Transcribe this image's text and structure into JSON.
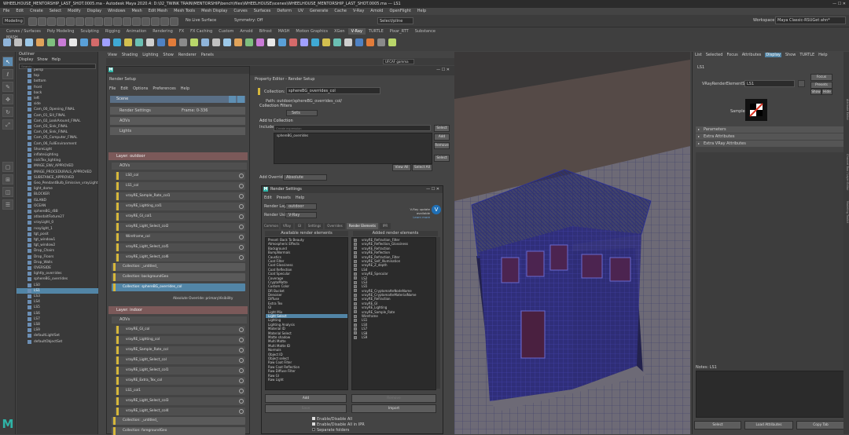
{
  "window": {
    "title": "WHEELHOUSE_MENTORSHIP_LAST_SHOT.0005.ma - Autodesk Maya 2020.4: D:\\02_TWINK TRAIN\\MENTORSHIP\\bench\\files\\WHEELHOUSE\\scenes\\WHEELHOUSE_MENTORSHIP_LAST_SHOT.0005.ma --- LS1"
  },
  "menu": [
    "File",
    "Edit",
    "Create",
    "Select",
    "Modify",
    "Display",
    "Windows",
    "Mesh",
    "Edit Mesh",
    "Mesh Tools",
    "Mesh Display",
    "Curves",
    "Surfaces",
    "Deform",
    "UV",
    "Generate",
    "Cache",
    "V-Ray",
    "Arnold",
    "OpenFlight",
    "Help"
  ],
  "status": {
    "mode": "Modeling",
    "no_live": "No Live Surface",
    "symmetry": "Symmetry: Off",
    "target": "Select/pline",
    "workspace_label": "Workspace :",
    "workspace": "Maya Classic-RSUGet ahn*"
  },
  "shelf_tabs": [
    "Curves / Surfaces",
    "Poly Modeling",
    "Sculpting",
    "Rigging",
    "Animation",
    "Rendering",
    "FX",
    "FX Caching",
    "Custom",
    "Arnold",
    "Bifrost",
    "MASH",
    "Motion Graphics",
    "XGen",
    "V-Ray",
    "TURTLE",
    "Pixar_RTT",
    "Substance",
    "MASH"
  ],
  "outliner": {
    "title": "Outliner",
    "menus": [
      "Display",
      "Show",
      "Help"
    ],
    "search_placeholder": "Search...",
    "items": [
      "persp",
      "top",
      "bottom",
      "front",
      "back",
      "left",
      "side",
      "Cam_00_Opening_FINAL",
      "Cam_01_Sill_FINAL",
      "Cam_02_LookAround_FINAL",
      "Cam_03_Sink_FINAL",
      "Cam_04_Sink_FINAL",
      "Cam_05_Computer_FINAL",
      "Cam_06_FullEnvironment",
      "ShoreLight",
      "inflateLighting",
      "nickTex_lighting",
      "IMAGE_ENV_APPROVED",
      "IMAGE_PROCEDURALS_APPROVED",
      "SUBSTANCE_APPROVED",
      "Geo_PendantBulb_Emissive_vrayLight",
      "light_dome",
      "BLOCKER",
      "ISLAND",
      "OCEAN",
      "sphereBG_rBB",
      "atlasdaltFixture27",
      "vrayLight_0",
      "rvaylight_1",
      "tgt_posit",
      "tgt_window1",
      "tgt_window2",
      "Drop_Chairs",
      "Drop_Floors",
      "Drop_Walls",
      "OVERSIDE",
      "lightly_overrides",
      "sphereBG_overrides",
      "LS0",
      "LS1",
      "LS3",
      "LS4",
      "LS5",
      "LS6",
      "LS7",
      "LS8",
      "LS9",
      "defaultLightSet",
      "defaultObjectSet"
    ],
    "selected_index": 39
  },
  "viewport": {
    "menus": [
      "View",
      "Shading",
      "Lighting",
      "Show",
      "Renderer",
      "Panels"
    ],
    "camera_field": "UFCAF gamma"
  },
  "render_setup": {
    "title": "Render Setup",
    "menus": [
      "File",
      "Edit",
      "Options",
      "Preferences",
      "Help"
    ],
    "scene": "Scene",
    "scene_items": [
      "Render Settings",
      "AOVs",
      "Lights"
    ],
    "frame": "Frame: 0-336",
    "layer1": "Layer:  outdoor",
    "aovs": "AOVs",
    "aov_items1": [
      "LS0_col",
      "LS1_col",
      "vrayRE_Sample_Rate_col1",
      "vrayRE_Lighting_col1",
      "vrayRE_GI_col1",
      "vrayRE_Light_Select_col2",
      "Wireframe_col",
      "vrayRE_Light_Select_col5",
      "vrayRE_Light_Select_col6"
    ],
    "collections1": [
      "Collection:  _untitled_",
      "Collection:  backgroundGeo",
      "Collection:  sphereBG_overrides_col"
    ],
    "abs_override": "Absolute Override:  primaryVisibility",
    "layer2": "Layer:  indoor",
    "aov_items2": [
      "vrayRE_GI_col",
      "vrayRE_Lighting_col",
      "vrayRE_Sample_Rate_col",
      "vrayRE_Light_Select_col",
      "vrayRE_Light_Select_col1",
      "vrayRE_Extra_Tex_col",
      "LS1_col1",
      "vrayRE_Light_Select_col3",
      "vrayRE_Light_Select_col4"
    ],
    "collections2": [
      "Collection:  _untitled_",
      "Collection:  foregroundGeo"
    ]
  },
  "property_editor": {
    "title": "Property Editor - Render Setup",
    "collection_label": "Collection:",
    "collection_value": "sphereBG_overrides_col",
    "path": "Path:  outdoor/sphereBG_overrides_col/",
    "filters": "Collection Filters",
    "filter_value": "Sets",
    "add_to": "Add to Collection",
    "include": "Include",
    "include_placeholder": "Create expression",
    "select": "Select",
    "list_item": "sphereBG_overrides",
    "add": "Add",
    "remove": "Remove",
    "select2": "Select",
    "view_all": "View All",
    "select_all": "Select All",
    "add_override": "Add Override",
    "override_type": "Absolute"
  },
  "render_settings": {
    "title": "Render Settings",
    "menus": [
      "Edit",
      "Presets",
      "Help"
    ],
    "layer_label": "Render Layer",
    "layer_value": "outdoor",
    "using_label": "Render Using",
    "using_value": "V-Ray",
    "update": "V-Ray update available",
    "learn_more": "Learn more",
    "tabs": [
      "Common",
      "VRay",
      "GI",
      "Settings",
      "Overrides",
      "Render Elements",
      "IPR"
    ],
    "active_tab": "Render Elements",
    "available_header": "Available render elements",
    "added_header": "Added render elements",
    "available": [
      "Preset: Back To Beauty",
      "Atmospheric Effects",
      "Background",
      "BumpNormals",
      "Caustics",
      "Coat Filter",
      "Coat Glossiness",
      "Coat Reflection",
      "Coat Specular",
      "Coverage",
      "CryptoMatte",
      "Custom Color",
      "DR Bucket",
      "Denoiser",
      "Diffuse",
      "Extra Tex",
      "GI",
      "Light Mix",
      "Light Select",
      "Lighting",
      "Lighting Analysis",
      "Material ID",
      "Material Select",
      "Matte shadow",
      "Multi Matte",
      "Multi Matte ID",
      "Normals",
      "Object ID",
      "Object select",
      "Raw Coat Filter",
      "Raw Coat Reflection",
      "Raw Diffuse Filter",
      "Raw GI",
      "Raw Light"
    ],
    "available_selected": 18,
    "added": [
      "vrayRE_Refraction_Filter",
      "vrayRE_Reflection_Glossiness",
      "vrayRE_Refraction",
      "vrayRE_Reflection",
      "vrayRE_Refraction_Filter",
      "vrayRE_Self_Illumination",
      "vrayRE_Z_depth",
      "LS4",
      "vrayRE_Specular",
      "LS2",
      "LS3",
      "LS5",
      "vrayRE_CryptomatteNodeName",
      "vrayRE_CryptomatteMaterialName",
      "vrayRE_Refraction",
      "vrayRE_GI",
      "vrayRE_Lighting",
      "vrayRE_Sample_Rate",
      "Wireframe",
      "LS1",
      "LS0",
      "LS7",
      "LS8",
      "LS9"
    ],
    "add_btn": "Add",
    "remove_btn": "Remove",
    "save_btn": "Save",
    "import_btn": "Import",
    "checks": [
      "Enable/Disable All",
      "Enable/Disable All in IPR",
      "Separate folders"
    ]
  },
  "attribute_editor": {
    "menus": [
      "List",
      "Selected",
      "Focus",
      "Attributes",
      "Display",
      "Show",
      "TURTLE",
      "Help"
    ],
    "node": "LS1",
    "field_label": "VRayRenderElementSet:",
    "field_value": "LS1",
    "focus": "Focus",
    "presets": "Presets",
    "show": "Show",
    "hide": "Hide",
    "sample": "Sample",
    "sections": [
      "Parameters",
      "Extra Attributes",
      "Extra VRay Attributes"
    ],
    "notes": "Notes:  LS1",
    "select": "Select",
    "load": "Load Attributes",
    "copy": "Copy Tab",
    "side_tabs": [
      "Attribute Editor",
      "Channel Box / Layer Editor",
      "Modeling Toolkit",
      "Attribute Editor"
    ]
  }
}
